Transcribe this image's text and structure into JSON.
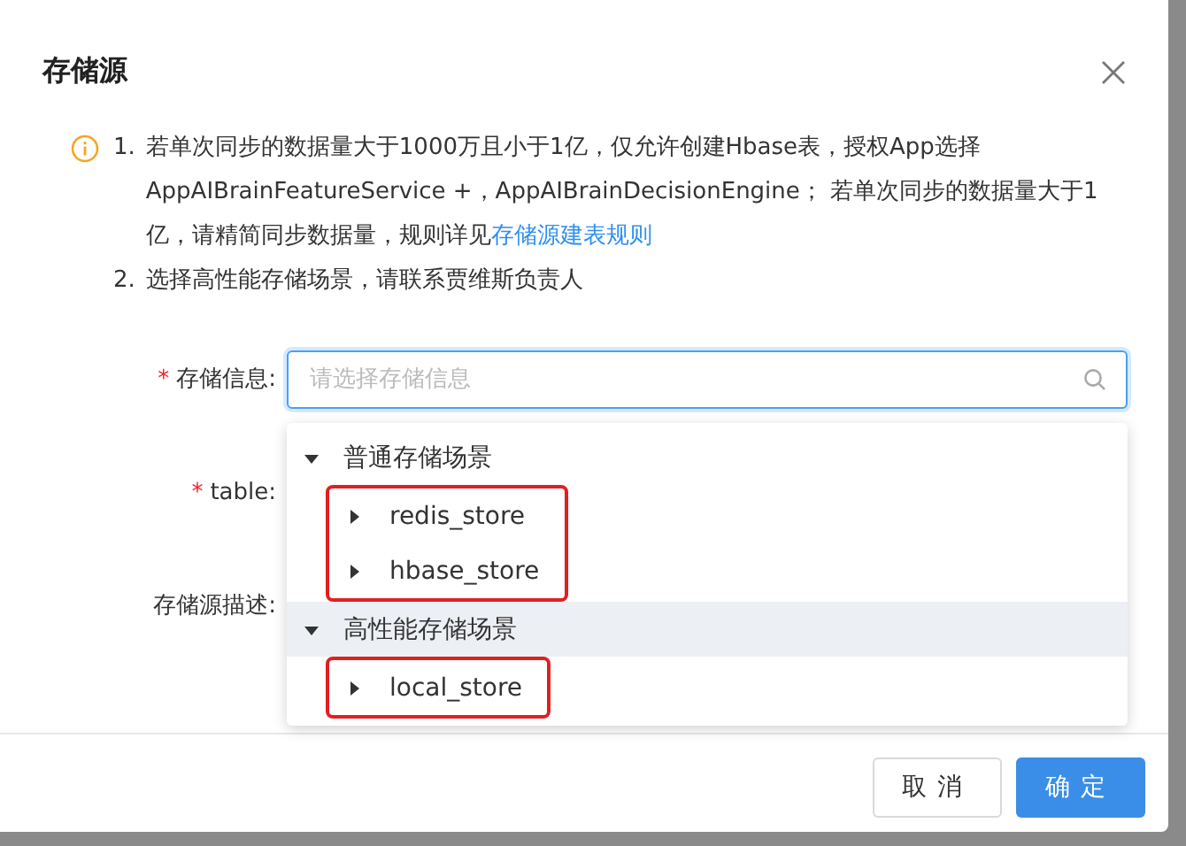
{
  "dialog": {
    "title": "存储源"
  },
  "notice": {
    "items": [
      {
        "number": "1.",
        "text": "若单次同步的数据量大于1000万且小于1亿，仅允许创建Hbase表，授权App选择AppAIBrainFeatureService +，AppAIBrainDecisionEngine； 若单次同步的数据量大于1亿，请精简同步数据量，规则详见",
        "link": "存储源建表规则"
      },
      {
        "number": "2.",
        "text": "选择高性能存储场景，请联系贾维斯负责人"
      }
    ]
  },
  "form": {
    "fields": [
      {
        "label": "存储信息:",
        "required_mark": "*",
        "placeholder": "请选择存储信息"
      },
      {
        "label": "table:",
        "required_mark": "*"
      },
      {
        "label": "存储源描述:"
      }
    ]
  },
  "dropdown": {
    "groups": [
      {
        "label": "普通存储场景",
        "expanded": true,
        "highlighted": false,
        "annotated": true,
        "children": [
          {
            "label": "redis_store",
            "expanded": false
          },
          {
            "label": "hbase_store",
            "expanded": false
          }
        ]
      },
      {
        "label": "高性能存储场景",
        "expanded": true,
        "highlighted": true,
        "annotated": true,
        "children": [
          {
            "label": "local_store",
            "expanded": false
          }
        ]
      }
    ]
  },
  "buttons": [
    {
      "label": "取消",
      "kind": "default"
    },
    {
      "label": "确定",
      "kind": "primary"
    }
  ]
}
